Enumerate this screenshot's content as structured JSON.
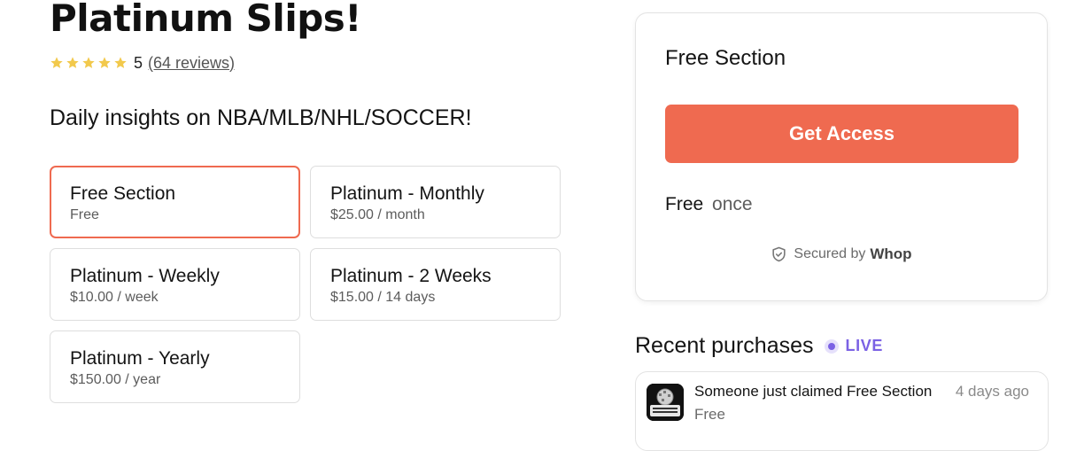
{
  "product": {
    "title": "Platinum Slips!",
    "rating": {
      "score": "5",
      "reviews": "(64 reviews)",
      "stars": 5
    },
    "tagline": "Daily insights on NBA/MLB/NHL/SOCCER!"
  },
  "plans": [
    {
      "name": "Free Section",
      "price": "Free",
      "selected": true
    },
    {
      "name": "Platinum - Monthly",
      "price": "$25.00 / month",
      "selected": false
    },
    {
      "name": "Platinum - Weekly",
      "price": "$10.00 / week",
      "selected": false
    },
    {
      "name": "Platinum - 2 Weeks",
      "price": "$15.00 / 14 days",
      "selected": false
    },
    {
      "name": "Platinum - Yearly",
      "price": "$150.00 / year",
      "selected": false
    }
  ],
  "checkout": {
    "title": "Free Section",
    "button_label": "Get Access",
    "price_amount": "Free",
    "price_period": "once",
    "secured_label": "Secured by",
    "secured_brand": "Whop"
  },
  "recent": {
    "title": "Recent purchases",
    "live_label": "LIVE",
    "items": [
      {
        "text": "Someone just claimed Free Section",
        "sub": "Free",
        "time": "4 days ago",
        "avatar_icon": "platinum-slips-logo-icon"
      }
    ]
  },
  "colors": {
    "accent": "#ef6a50",
    "star": "#f2c94c",
    "live": "#7b62e4",
    "text": "#141414",
    "muted": "#5c5c5c"
  }
}
